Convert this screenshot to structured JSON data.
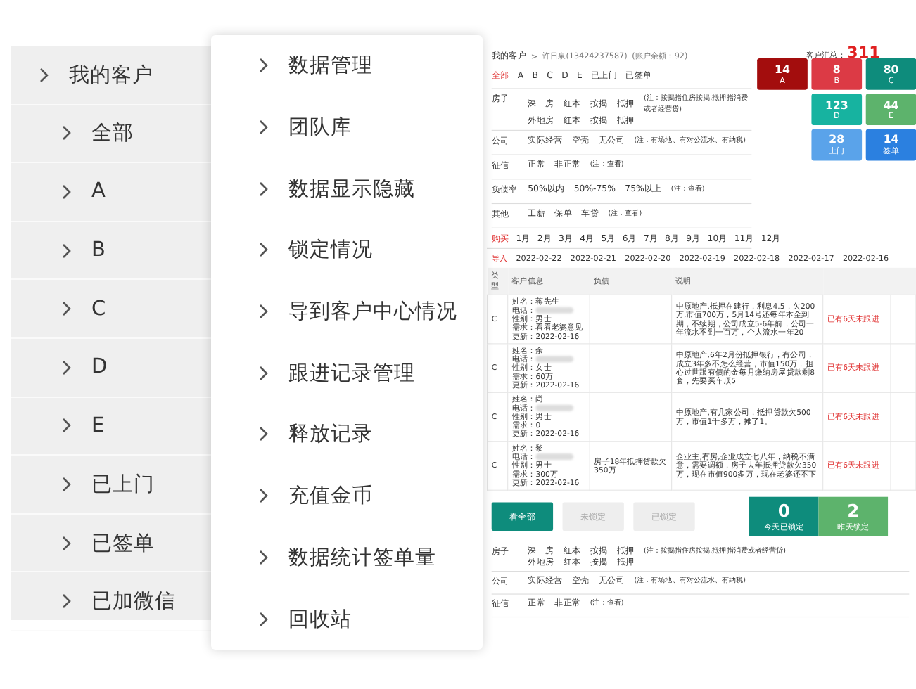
{
  "customer_menu": {
    "title": "我的客户",
    "items": [
      "全部",
      "A",
      "B",
      "C",
      "D",
      "E",
      "已上门",
      "已签单",
      "已加微信"
    ]
  },
  "data_menu": {
    "items": [
      "数据管理",
      "团队库",
      "数据显示隐藏",
      "锁定情况",
      "导到客户中心情况",
      "跟进记录管理",
      "释放记录",
      "充值金币",
      "数据统计签单量",
      "回收站"
    ]
  },
  "customer_page": {
    "breadcrumb": {
      "root": "我的客户",
      "separator": ">",
      "user": "许日泉(13424237587)",
      "balance": "(账户余额：92)"
    },
    "total": {
      "label": "客户汇总：",
      "value": "311"
    },
    "grade_filters": [
      {
        "label": "全部",
        "selected": true
      },
      {
        "label": "A",
        "selected": false
      },
      {
        "label": "B",
        "selected": false
      },
      {
        "label": "C",
        "selected": false
      },
      {
        "label": "D",
        "selected": false
      },
      {
        "label": "E",
        "selected": false
      },
      {
        "label": "已上门",
        "selected": false
      },
      {
        "label": "已签单",
        "selected": false
      }
    ],
    "stat_tiles": [
      {
        "count": "14",
        "label": "A",
        "color": "#a30d0d"
      },
      {
        "count": "8",
        "label": "B",
        "color": "#dc3a45"
      },
      {
        "count": "80",
        "label": "C",
        "color": "#0e8c7c"
      },
      {
        "count": "123",
        "label": "D",
        "color": "#17b3a0"
      },
      {
        "count": "44",
        "label": "E",
        "color": "#5db36c"
      },
      {
        "count": "28",
        "label": "上门",
        "color": "#5aa3ea"
      },
      {
        "count": "14",
        "label": "签单",
        "color": "#2b80e0"
      }
    ],
    "filter_rows": [
      {
        "label": "房子",
        "lines": [
          [
            "深　房",
            "红本",
            "按揭",
            "抵押"
          ],
          [
            "外地房",
            "红本",
            "按揭",
            "抵押"
          ]
        ],
        "note": "(注：按揭指住房按揭,抵押指消费或者经营贷)"
      },
      {
        "label": "公司",
        "lines": [
          [
            "实际经营",
            "空壳",
            "无公司"
          ]
        ],
        "note": "(注：有场地、有对公流水、有纳税)"
      },
      {
        "label": "征信",
        "lines": [
          [
            "正常",
            "非正常"
          ]
        ],
        "note": "(注：查看)"
      },
      {
        "label": "负债率",
        "lines": [
          [
            "50%以内",
            "50%-75%",
            "75%以上"
          ]
        ],
        "note": "(注：查看)"
      },
      {
        "label": "其他",
        "lines": [
          [
            "工薪",
            "保单",
            "车贷"
          ]
        ],
        "note": "(注：查看)"
      }
    ],
    "months": {
      "label": "购买",
      "items": [
        "1月",
        "2月",
        "3月",
        "4月",
        "5月",
        "6月",
        "7月",
        "8月",
        "9月",
        "10月",
        "11月",
        "12月"
      ]
    },
    "dates": {
      "label": "导入",
      "items": [
        "2022-02-22",
        "2022-02-21",
        "2022-02-20",
        "2022-02-19",
        "2022-02-18",
        "2022-02-17",
        "2022-02-16"
      ]
    },
    "table": {
      "columns": [
        "类型",
        "客户信息",
        "负债",
        "说明"
      ],
      "rows": [
        {
          "type": "C",
          "name": "姓名：蒋先生",
          "phone": "电话：",
          "gender": "性别：男士",
          "need": "需求：看看老婆意见",
          "updated": "更新：2022-02-16",
          "debt": "",
          "note": "中原地产,抵押在建行，利息4.5，欠200万,市值700万，5月14号还每年本金到期，不续期，公司成立5-6年前，公司一年流水不到一百万，个人流水一年20",
          "status": "已有6天未跟进"
        },
        {
          "type": "C",
          "name": "姓名：余",
          "phone": "电话：",
          "gender": "性别：女士",
          "need": "需求：60万",
          "updated": "更新：2022-02-16",
          "debt": "",
          "note": "中原地产,6年2月份抵押银行，有公司，成立3年多不怎么经营，市值150万，担心过世跟有债的金每月缴纳房屋贷款剩8套，先要买车顶5",
          "status": "已有6天未跟进"
        },
        {
          "type": "C",
          "name": "姓名：尚",
          "phone": "电话：",
          "gender": "性别：男士",
          "need": "需求：0",
          "updated": "更新：2022-02-16",
          "debt": "",
          "note": "中原地产,有几家公司，抵押贷款欠500万，市值1千多万，摊了1。",
          "status": "已有6天未跟进"
        },
        {
          "type": "C",
          "name": "姓名：黎",
          "phone": "电话：",
          "gender": "性别：男士",
          "need": "需求：300万",
          "updated": "更新：2022-02-16",
          "debt": "房子18年抵押贷款欠350万",
          "note": "企业主,有房,企业成立七八年，纳税不满意，需要调额，房子去年抵押贷款欠350万，现在市值900多万，现在老婆还不下",
          "status": "已有6天未跟进"
        }
      ]
    },
    "lock_buttons": [
      {
        "label": "看全部",
        "selected": true
      },
      {
        "label": "未锁定",
        "selected": false
      },
      {
        "label": "已锁定",
        "selected": false
      }
    ],
    "lock_stats": [
      {
        "count": "0",
        "label": "今天已锁定",
        "color": "#0e8c7c"
      },
      {
        "count": "2",
        "label": "昨天锁定",
        "color": "#5db36c"
      }
    ],
    "bottom_filters": [
      {
        "label": "房子",
        "lines": [
          [
            "深　房",
            "红本",
            "按揭",
            "抵押"
          ],
          [
            "外地房",
            "红本",
            "按揭",
            "抵押"
          ]
        ],
        "note": "(注：按揭指住房按揭,抵押指消费或者经营贷)"
      },
      {
        "label": "公司",
        "lines": [
          [
            "实际经营",
            "空壳",
            "无公司"
          ]
        ],
        "note": "(注：有场地、有对公流水、有纳税)"
      },
      {
        "label": "征信",
        "lines": [
          [
            "正常",
            "非正常"
          ]
        ],
        "note": "(注：查看)"
      }
    ]
  }
}
